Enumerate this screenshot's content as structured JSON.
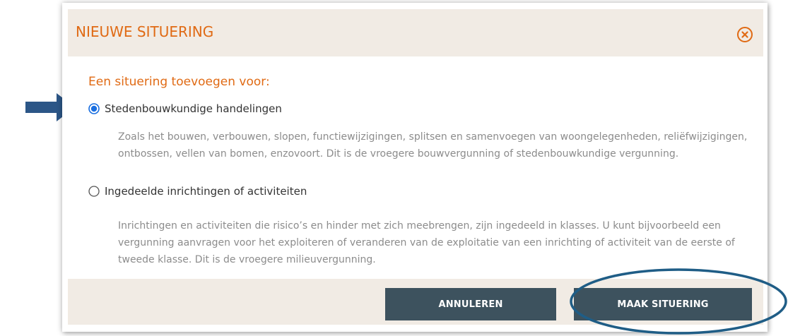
{
  "dialog": {
    "title": "NIEUWE SITUERING",
    "close_icon": "close-circle-icon"
  },
  "body": {
    "subtitle": "Een situering toevoegen voor:",
    "options": [
      {
        "label": "Stedenbouwkundige handelingen",
        "selected": true,
        "description": "Zoals het bouwen, verbouwen, slopen, functiewijzigingen, splitsen en samenvoegen van woongelegenheden, reliëfwijzigingen, ontbossen, vellen van bomen, enzovoort. Dit is de vroegere bouwvergunning of stedenbouwkundige vergunning."
      },
      {
        "label": "Ingedeelde inrichtingen of activiteiten",
        "selected": false,
        "description": "Inrichtingen en activiteiten die risico’s en hinder met zich meebrengen, zijn ingedeeld in klasses. U kunt bijvoorbeeld een vergunning aanvragen voor het exploiteren of veranderen van de exploitatie van een inrichting of activiteit van de eerste of tweede klasse. Dit is de vroegere milieuvergunning."
      }
    ]
  },
  "footer": {
    "cancel_label": "ANNULEREN",
    "submit_label": "MAAK SITUERING"
  },
  "annotations": {
    "arrow_icon": "arrow-right-icon",
    "highlight": "ellipse-highlight"
  },
  "colors": {
    "accent_orange": "#e06a14",
    "header_bg": "#f1ebe4",
    "button_bg": "#3d525e",
    "radio_blue": "#1a6fe0",
    "annotation_blue": "#2c5687",
    "ellipse_blue": "#1f5d86",
    "muted_text": "#8c8c8c"
  }
}
